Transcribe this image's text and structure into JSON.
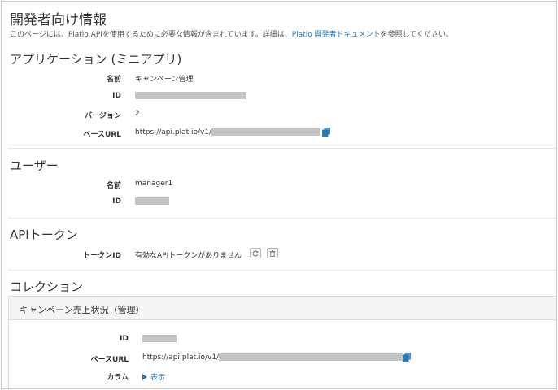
{
  "page": {
    "title": "開発者向け情報",
    "intro_before": "このページには、Platio APIを使用するために必要な情報が含まれています。詳細は、",
    "intro_link": "Platio 開発者ドキュメント",
    "intro_after": "を参照してください。"
  },
  "application": {
    "section_title": "アプリケーション (ミニアプリ)",
    "name_label": "名前",
    "name_value": "キャンペーン管理",
    "id_label": "ID",
    "version_label": "バージョン",
    "version_value": "2",
    "base_url_label": "ベースURL",
    "base_url_prefix": "https://api.plat.io/v1/"
  },
  "user": {
    "section_title": "ユーザー",
    "name_label": "名前",
    "name_value": "manager1",
    "id_label": "ID"
  },
  "api_token": {
    "section_title": "APIトークン",
    "token_id_label": "トークンID",
    "token_id_value": "有効なAPIトークンがありません"
  },
  "collection": {
    "section_title": "コレクション",
    "panel_title": "キャンペーン売上状況（管理）",
    "id_label": "ID",
    "base_url_label": "ベースURL",
    "base_url_prefix": "https://api.plat.io/v1/",
    "column_label": "カラム",
    "column_toggle": "表示"
  },
  "icons": {
    "copy": "copy-icon",
    "refresh": "refresh-icon",
    "trash": "trash-icon",
    "expand": "caret-right-icon"
  },
  "colors": {
    "link": "#2a7ab8",
    "masked": "#c4c4c4",
    "panel_header": "#f5f5f5",
    "divider": "#e6e6e6"
  }
}
